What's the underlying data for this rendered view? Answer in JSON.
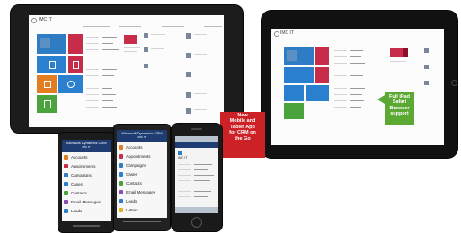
{
  "left_tablet": {
    "app_title": "IMC IT",
    "tile_colors": [
      "#2e7dc4",
      "#c72c48",
      "#2b7fcf",
      "#e37d22",
      "#2b7fcf",
      "#4aa33d"
    ]
  },
  "right_tablet": {
    "app_title": "IMC IT",
    "tile_colors": [
      "#2e7dc4",
      "#c72c48",
      "#2b7fcf",
      "#e37d22",
      "#2b7fcf",
      "#4aa33d"
    ]
  },
  "callout_red": {
    "lines": [
      "New",
      "Mobile and",
      "Tablet App",
      "for CRM on",
      "the Go"
    ],
    "color": "#cc2127"
  },
  "callout_green": {
    "lines": [
      "Full iPad",
      "Safari",
      "Browser",
      "support"
    ],
    "color": "#5ba832"
  },
  "phone_android": {
    "header_title": "Microsoft Dynamics CRM",
    "header_subtitle": "IMC IT",
    "items": [
      "Accounts",
      "Appointments",
      "Campaigns",
      "Cases",
      "Contacts",
      "Email Messages",
      "Leads"
    ]
  },
  "phone_windows": {
    "header_title": "Microsoft Dynamics CRM",
    "header_subtitle": "IMC IT",
    "items": [
      "Accounts",
      "Appointments",
      "Campaigns",
      "Cases",
      "Contacts",
      "Email Messages",
      "Leads",
      "Letters"
    ]
  },
  "phone_iphone": {
    "record_title": "IMC IT"
  },
  "list_icon_colors": [
    "#e37d22",
    "#c72c48",
    "#2e7dc4",
    "#2b7fcf",
    "#4aa33d",
    "#8a4fb6",
    "#2e7dc4",
    "#e0b020"
  ]
}
